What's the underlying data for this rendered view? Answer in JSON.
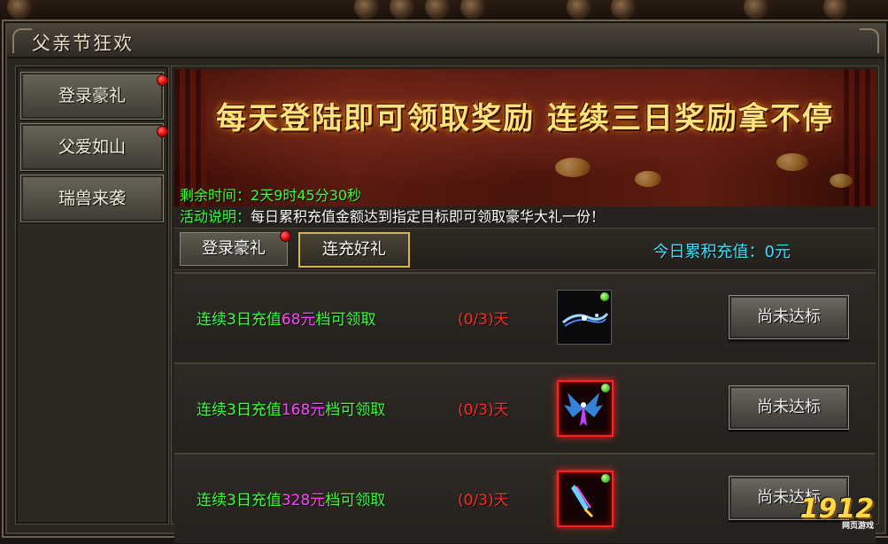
{
  "window": {
    "title": "父亲节狂欢"
  },
  "sidebar": {
    "items": [
      {
        "label": "登录豪礼",
        "badge": true
      },
      {
        "label": "父爱如山",
        "badge": true
      },
      {
        "label": "瑞兽来袭",
        "badge": false
      }
    ]
  },
  "banner": {
    "headline": "每天登陆即可领取奖励 连续三日奖励拿不停",
    "remaining_label": "剩余时间：",
    "remaining_value": "2天9时45分30秒",
    "desc_label": "活动说明：",
    "desc_value": "每日累积充值金额达到指定目标即可领取豪华大礼一份！"
  },
  "tabs": [
    {
      "label": "登录豪礼",
      "badge": true,
      "active": false
    },
    {
      "label": "连充好礼",
      "badge": false,
      "active": true
    }
  ],
  "today": {
    "label": "今日累积充值：",
    "amount": "0",
    "unit": "元"
  },
  "rewards": [
    {
      "req_prefix": "连续3日充值",
      "amount": "68元",
      "req_suffix": "档可领取",
      "progress": "(0/3)天",
      "item_icon": "scroll-item-icon",
      "item_frame": "normal",
      "button": "尚未达标"
    },
    {
      "req_prefix": "连续3日充值",
      "amount": "168元",
      "req_suffix": "档可领取",
      "progress": "(0/3)天",
      "item_icon": "wings-item-icon",
      "item_frame": "red",
      "button": "尚未达标"
    },
    {
      "req_prefix": "连续3日充值",
      "amount": "328元",
      "req_suffix": "档可领取",
      "progress": "(0/3)天",
      "item_icon": "blade-item-icon",
      "item_frame": "red",
      "button": "尚未达标"
    }
  ],
  "watermark": {
    "logo": "1912",
    "sub": "网页游戏"
  }
}
